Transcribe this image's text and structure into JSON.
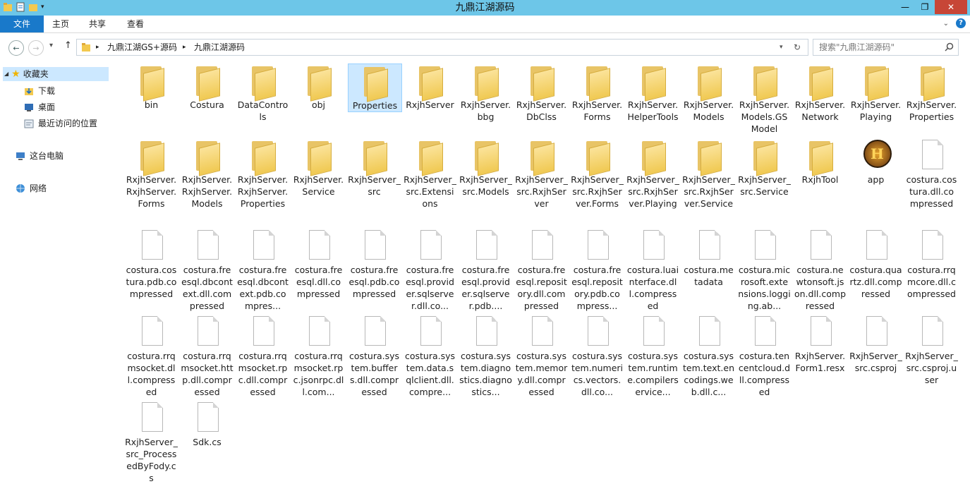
{
  "window": {
    "title": "九鼎江湖源码"
  },
  "ribbon": {
    "tabs": [
      "文件",
      "主页",
      "共享",
      "查看"
    ]
  },
  "nav": {
    "back_label": "←",
    "forward_label": "→",
    "recent_label": "▾",
    "up_label": "↑",
    "address_parts": [
      "九鼎江湖GS+源码",
      "九鼎江湖源码"
    ],
    "refresh_label": "↻",
    "search_placeholder": "搜索\"九鼎江湖源码\""
  },
  "sidebar": {
    "favorites_label": "收藏夹",
    "favorites": [
      "下载",
      "桌面",
      "最近访问的位置"
    ],
    "this_pc_label": "这台电脑",
    "network_label": "网络"
  },
  "files": [
    {
      "name": "bin",
      "type": "folder"
    },
    {
      "name": "Costura",
      "type": "folder"
    },
    {
      "name": "DataControls",
      "type": "folder"
    },
    {
      "name": "obj",
      "type": "folder"
    },
    {
      "name": "Properties",
      "type": "folder",
      "selected": true
    },
    {
      "name": "RxjhServer",
      "type": "folder"
    },
    {
      "name": "RxjhServer.bbg",
      "type": "folder"
    },
    {
      "name": "RxjhServer.DbClss",
      "type": "folder"
    },
    {
      "name": "RxjhServer.Forms",
      "type": "folder"
    },
    {
      "name": "RxjhServer.HelperTools",
      "type": "folder"
    },
    {
      "name": "RxjhServer.Models",
      "type": "folder"
    },
    {
      "name": "RxjhServer.Models.GSModel",
      "type": "folder"
    },
    {
      "name": "RxjhServer.Network",
      "type": "folder"
    },
    {
      "name": "RxjhServer.Playing",
      "type": "folder"
    },
    {
      "name": "RxjhServer.Properties",
      "type": "folder"
    },
    {
      "name": "RxjhServer.RxjhServer.Forms",
      "type": "folder"
    },
    {
      "name": "RxjhServer.RxjhServer.Models",
      "type": "folder"
    },
    {
      "name": "RxjhServer.RxjhServer.Properties",
      "type": "folder"
    },
    {
      "name": "RxjhServer.Service",
      "type": "folder"
    },
    {
      "name": "RxjhServer_src",
      "type": "folder"
    },
    {
      "name": "RxjhServer_src.Extensions",
      "type": "folder"
    },
    {
      "name": "RxjhServer_src.Models",
      "type": "folder"
    },
    {
      "name": "RxjhServer_src.RxjhServer",
      "type": "folder"
    },
    {
      "name": "RxjhServer_src.RxjhServer.Forms",
      "type": "folder"
    },
    {
      "name": "RxjhServer_src.RxjhServer.Playing",
      "type": "folder"
    },
    {
      "name": "RxjhServer_src.RxjhServer.Service",
      "type": "folder"
    },
    {
      "name": "RxjhServer_src.Service",
      "type": "folder"
    },
    {
      "name": "RxjhTool",
      "type": "folder"
    },
    {
      "name": "app",
      "type": "app"
    },
    {
      "name": "costura.costura.dll.compressed",
      "type": "file"
    },
    {
      "name": "costura.costura.pdb.compressed",
      "type": "file"
    },
    {
      "name": "costura.freesql.dbcontext.dll.compressed",
      "type": "file"
    },
    {
      "name": "costura.freesql.dbcontext.pdb.compres...",
      "type": "file"
    },
    {
      "name": "costura.freesql.dll.compressed",
      "type": "file"
    },
    {
      "name": "costura.freesql.pdb.compressed",
      "type": "file"
    },
    {
      "name": "costura.freesql.provider.sqlserver.dll.co...",
      "type": "file"
    },
    {
      "name": "costura.freesql.provider.sqlserver.pdb....",
      "type": "file"
    },
    {
      "name": "costura.freesql.repository.dll.compressed",
      "type": "file"
    },
    {
      "name": "costura.freesql.repository.pdb.compress...",
      "type": "file"
    },
    {
      "name": "costura.luainterface.dll.compressed",
      "type": "file"
    },
    {
      "name": "costura.metadata",
      "type": "file"
    },
    {
      "name": "costura.microsoft.extensions.logging.ab...",
      "type": "file"
    },
    {
      "name": "costura.newtonsoft.json.dll.compressed",
      "type": "file"
    },
    {
      "name": "costura.quartz.dll.compressed",
      "type": "file"
    },
    {
      "name": "costura.rrqmcore.dll.compressed",
      "type": "file"
    },
    {
      "name": "costura.rrqmsocket.dll.compressed",
      "type": "file"
    },
    {
      "name": "costura.rrqmsocket.http.dll.compressed",
      "type": "file"
    },
    {
      "name": "costura.rrqmsocket.rpc.dll.compressed",
      "type": "file"
    },
    {
      "name": "costura.rrqmsocket.rpc.jsonrpc.dll.com...",
      "type": "file"
    },
    {
      "name": "costura.system.buffers.dll.compressed",
      "type": "file"
    },
    {
      "name": "costura.system.data.sqlclient.dll.compre...",
      "type": "file"
    },
    {
      "name": "costura.system.diagnostics.diagnostics...",
      "type": "file"
    },
    {
      "name": "costura.system.memory.dll.compressed",
      "type": "file"
    },
    {
      "name": "costura.system.numerics.vectors.dll.co...",
      "type": "file"
    },
    {
      "name": "costura.system.runtime.compilerservice...",
      "type": "file"
    },
    {
      "name": "costura.system.text.encodings.web.dll.c...",
      "type": "file"
    },
    {
      "name": "costura.tencentcloud.dll.compressed",
      "type": "file"
    },
    {
      "name": "RxjhServer.Form1.resx",
      "type": "file"
    },
    {
      "name": "RxjhServer_src.csproj",
      "type": "file"
    },
    {
      "name": "RxjhServer_src.csproj.user",
      "type": "file"
    },
    {
      "name": "RxjhServer_src_ProcessedByFody.cs",
      "type": "file"
    },
    {
      "name": "Sdk.cs",
      "type": "file"
    }
  ]
}
